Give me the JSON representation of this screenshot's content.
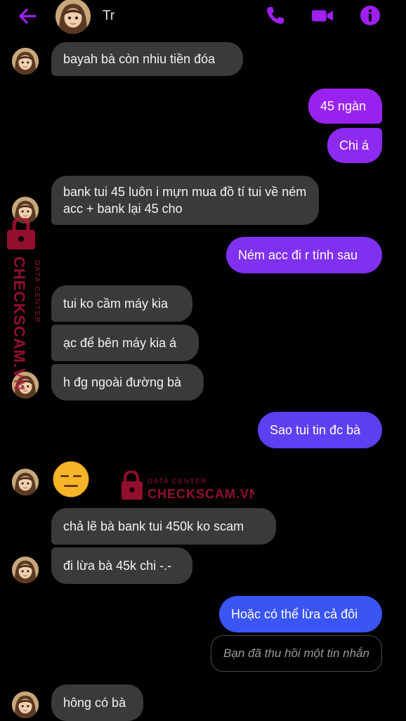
{
  "header": {
    "title": "Tr",
    "back_icon": "arrow-left-icon",
    "phone_icon": "phone-icon",
    "video_icon": "video-icon",
    "info_icon": "info-icon"
  },
  "colors": {
    "accent": "#a020f0",
    "incoming_bubble": "#3a3a3c",
    "watermark": "#c4143c"
  },
  "messages": [
    {
      "dir": "in",
      "text": "bayah bà còn nhiu tiền đóa"
    },
    {
      "dir": "out",
      "text": "45 ngàn"
    },
    {
      "dir": "out",
      "text": "Chi á"
    },
    {
      "dir": "in",
      "text": "bank tui 45 luôn  i mựn mua  đồ tí tui về ném acc  + bank lại 45 cho"
    },
    {
      "dir": "out",
      "text": "Ném acc đi r tính sau"
    },
    {
      "dir": "in",
      "text": "tui ko cầm máy kia"
    },
    {
      "dir": "in",
      "text": "ạc để bên máy kia á"
    },
    {
      "dir": "in",
      "text": "h đg ngoài đường bà"
    },
    {
      "dir": "out",
      "text": "Sao tui tin đc bà"
    },
    {
      "dir": "in",
      "text": "😑"
    },
    {
      "dir": "in",
      "text": "chả lẽ bà bank tui 450k ko scam"
    },
    {
      "dir": "in",
      "text": "đi lừa bà 45k chi -.-"
    },
    {
      "dir": "out",
      "text": "Hoặc có thể lừa cả đôi"
    },
    {
      "dir": "out",
      "text": "Bạn đã thu hồi một tin nhắn",
      "recalled": true
    },
    {
      "dir": "in",
      "text": "hông có bà"
    }
  ],
  "watermark": {
    "line1": "DATA CENTER",
    "line2": "CHECKSCAM.VN"
  }
}
